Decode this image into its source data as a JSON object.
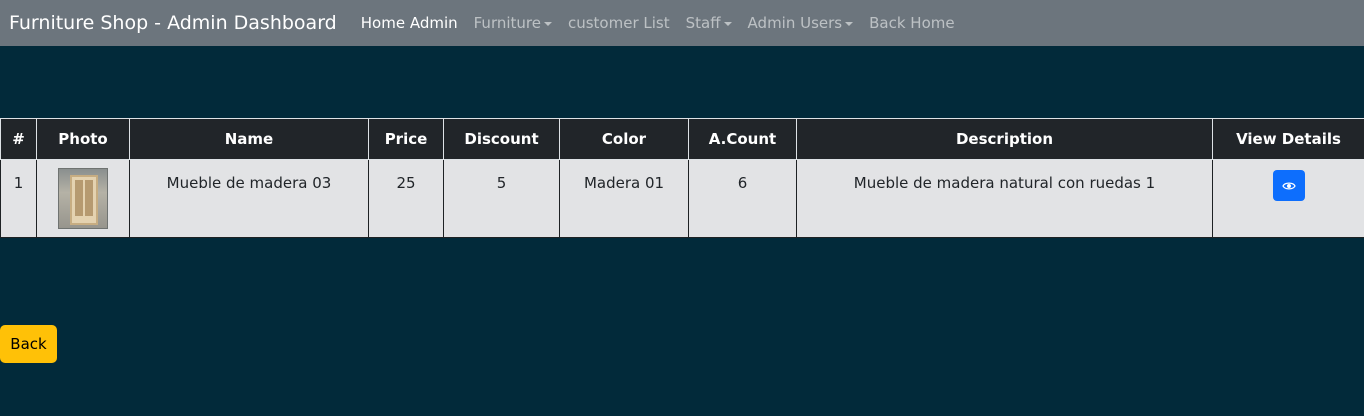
{
  "navbar": {
    "brand": "Furniture Shop - Admin Dashboard",
    "links": [
      {
        "label": "Home Admin",
        "active": true,
        "dropdown": false
      },
      {
        "label": "Furniture",
        "active": false,
        "dropdown": true
      },
      {
        "label": "customer List",
        "active": false,
        "dropdown": false
      },
      {
        "label": "Staff",
        "active": false,
        "dropdown": true
      },
      {
        "label": "Admin Users",
        "active": false,
        "dropdown": true
      },
      {
        "label": "Back Home",
        "active": false,
        "dropdown": false
      }
    ]
  },
  "table": {
    "headers": [
      "#",
      "Photo",
      "Name",
      "Price",
      "Discount",
      "Color",
      "A.Count",
      "Description",
      "View Details"
    ],
    "rows": [
      {
        "index": "1",
        "photo": "wooden-cabinet-photo",
        "name": "Mueble de madera 03",
        "price": "25",
        "discount": "5",
        "color": "Madera 01",
        "count": "6",
        "description": "Mueble de madera natural con ruedas 1",
        "view_icon": "eye-icon"
      }
    ]
  },
  "back_button": {
    "label": "Back"
  },
  "colors": {
    "navbar_bg": "#6c757d",
    "page_bg": "#022a3a",
    "table_header_bg": "#212529",
    "row_bg": "#e2e3e5",
    "primary": "#0d6efd",
    "warning": "#ffc107"
  }
}
